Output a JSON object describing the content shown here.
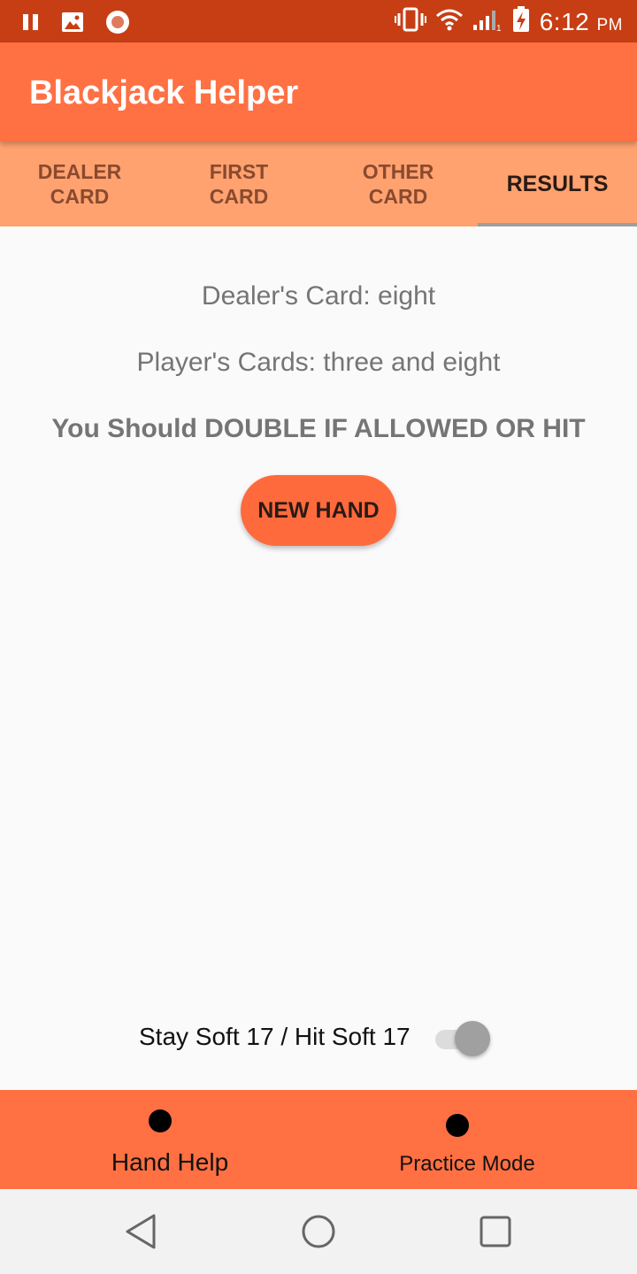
{
  "status_bar": {
    "time": "6:12",
    "ampm": "PM",
    "sim_label": "1",
    "icons": [
      "pause-icon",
      "image-icon",
      "record-icon",
      "vibrate-icon",
      "wifi-icon",
      "signal-icon",
      "battery-charging-icon"
    ]
  },
  "app": {
    "title": "Blackjack Helper"
  },
  "tabs": [
    {
      "label": "DEALER\nCARD",
      "line1": "DEALER",
      "line2": "CARD",
      "active": false
    },
    {
      "label": "FIRST\nCARD",
      "line1": "FIRST",
      "line2": "CARD",
      "active": false
    },
    {
      "label": "OTHER\nCARD",
      "line1": "OTHER",
      "line2": "CARD",
      "active": false
    },
    {
      "label": "RESULTS",
      "active": true
    }
  ],
  "results": {
    "dealer_line": "Dealer's Card: eight",
    "player_line": "Player's Cards: three and eight",
    "advice_line": "You Should DOUBLE IF ALLOWED OR HIT",
    "new_hand_label": "NEW HAND"
  },
  "toggle": {
    "label": "Stay Soft 17 / Hit Soft 17",
    "checked": true
  },
  "bottom_nav": [
    {
      "label": "Hand Help",
      "icon": "dot-icon"
    },
    {
      "label": "Practice Mode",
      "icon": "dot-icon"
    }
  ],
  "system_nav": [
    "back-icon",
    "home-icon",
    "recents-icon"
  ],
  "colors": {
    "primary": "#ff7043",
    "status_bar": "#c73e15",
    "tab_bar": "#ffa270",
    "button": "#ff6a3d"
  }
}
